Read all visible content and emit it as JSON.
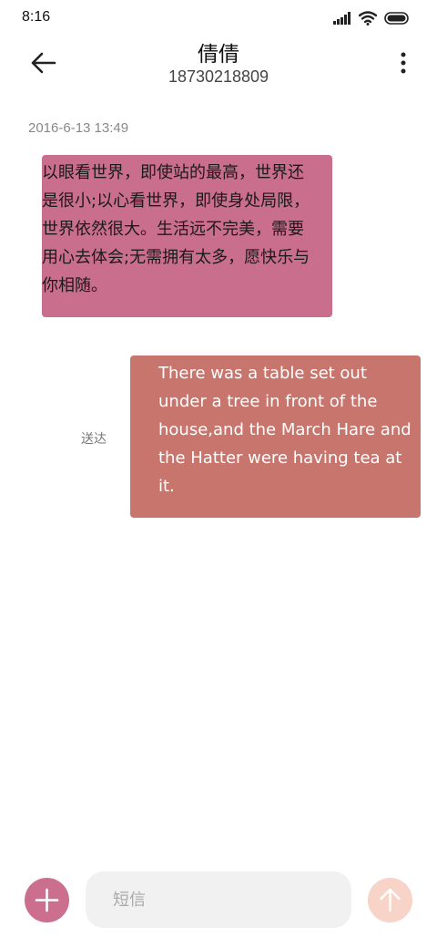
{
  "status_bar": {
    "time": "8:16",
    "icons": [
      "signal-icon",
      "wifi-icon",
      "battery-icon"
    ]
  },
  "header": {
    "contact_name": "倩倩",
    "contact_number": "18730218809",
    "back_icon": "arrow-left-icon",
    "more_icon": "more-vertical-icon"
  },
  "conversation": {
    "timestamp": "2016-6-13 13:49",
    "messages": [
      {
        "direction": "incoming",
        "text": "以眼看世界，即使站的最高，世界还是很小;以心看世界，即使身处局限，世界依然很大。生活远不完美，需要用心去体会;无需拥有太多，愿快乐与你相随。"
      },
      {
        "direction": "outgoing",
        "text": "There was a table set out under a tree in front of the house,and the March Hare and the Hatter were having tea at it.",
        "status": "送达"
      }
    ]
  },
  "composer": {
    "placeholder": "短信",
    "value": "",
    "add_icon": "plus-icon",
    "send_icon": "arrow-up-icon"
  },
  "colors": {
    "incoming_bubble": "#c96e8d",
    "outgoing_bubble": "#c8756d",
    "add_button": "#cc6f8f",
    "send_button": "#f8d3c8",
    "input_background": "#f1f1f1"
  }
}
